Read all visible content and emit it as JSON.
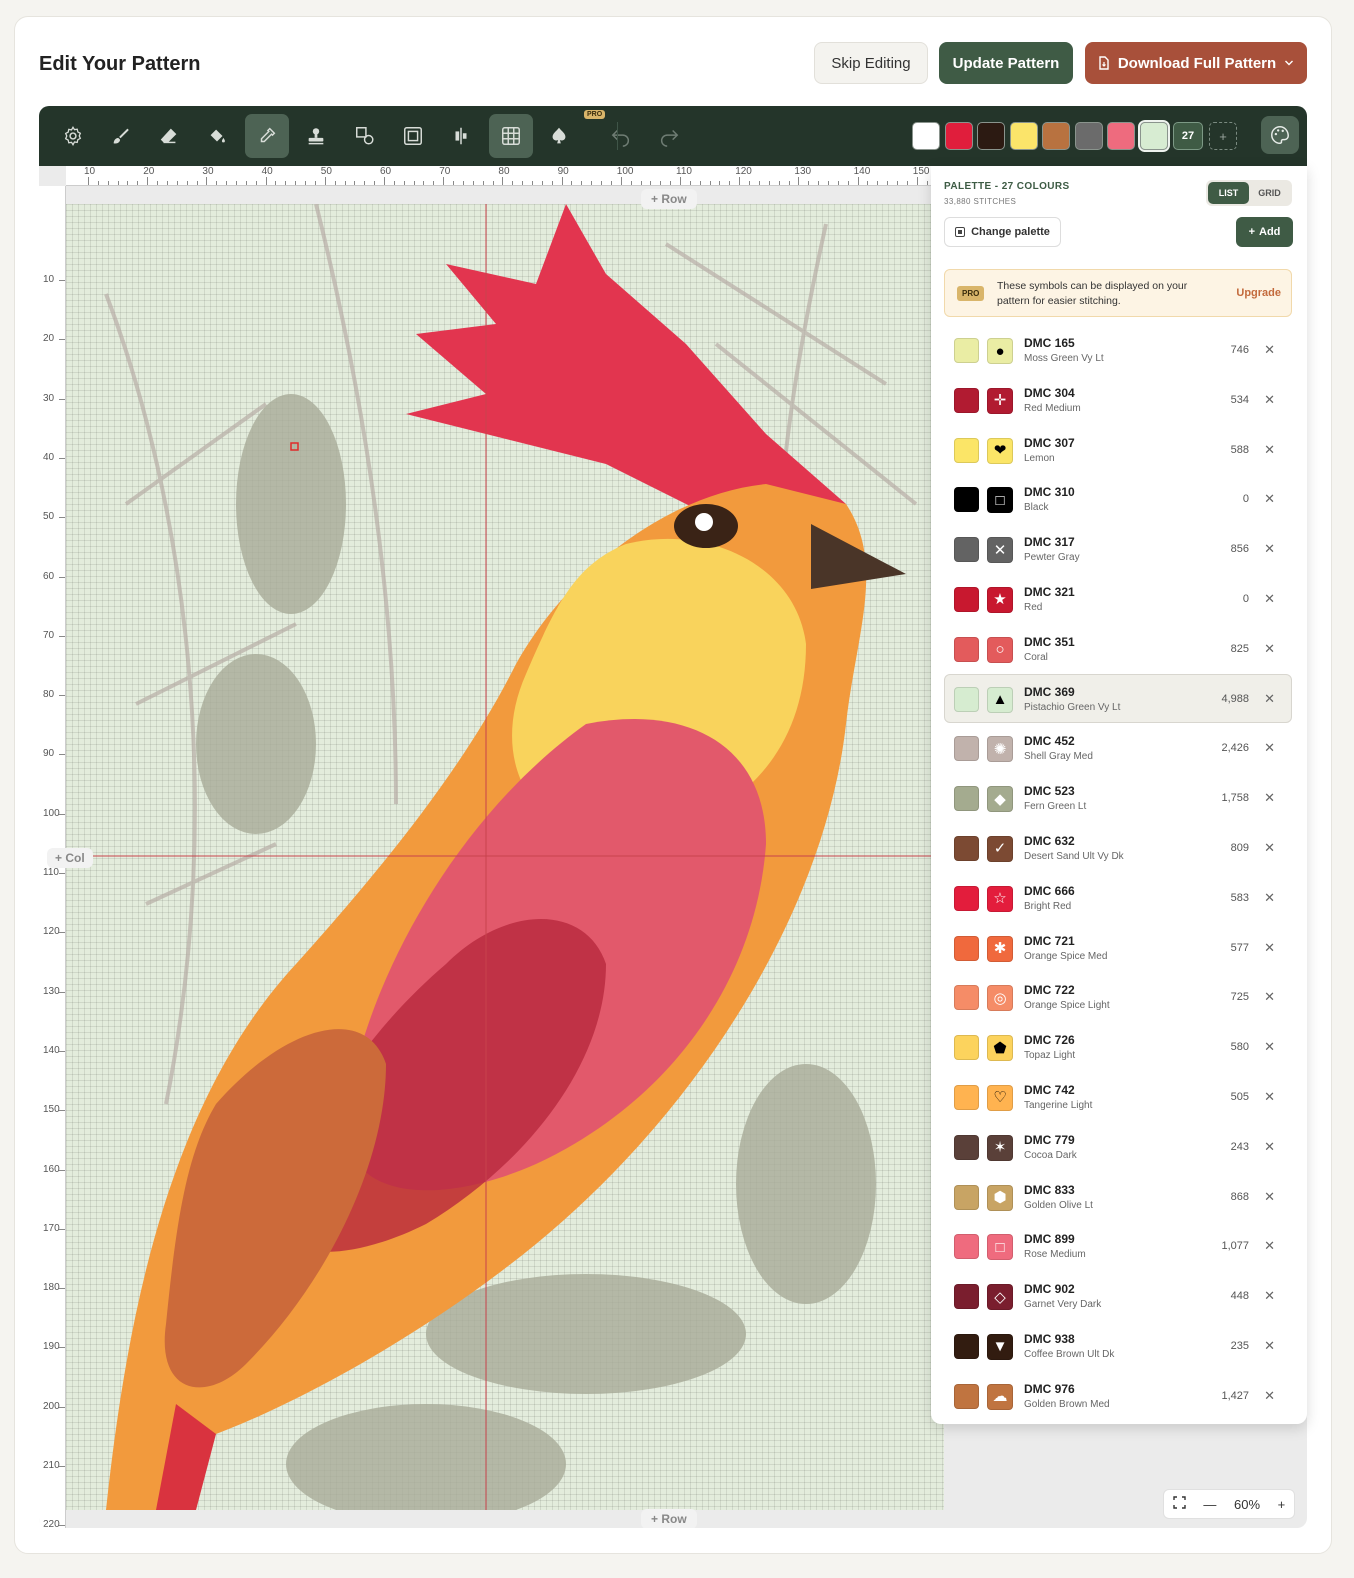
{
  "header": {
    "title": "Edit Your Pattern",
    "skip_label": "Skip Editing",
    "update_label": "Update Pattern",
    "download_label": "Download Full Pattern"
  },
  "toolbar": {
    "pro_badge": "PRO",
    "tools": [
      {
        "name": "settings-icon",
        "active": false
      },
      {
        "name": "brush-icon",
        "active": false
      },
      {
        "name": "eraser-icon",
        "active": false
      },
      {
        "name": "fill-bucket-icon",
        "active": false
      },
      {
        "name": "eyedropper-icon",
        "active": true
      },
      {
        "name": "stamp-icon",
        "active": false
      },
      {
        "name": "shapes-icon",
        "active": false
      },
      {
        "name": "frame-icon",
        "active": false
      },
      {
        "name": "align-icon",
        "active": false
      },
      {
        "name": "grid-icon",
        "active": true
      },
      {
        "name": "spade-icon",
        "active": false
      },
      {
        "name": "undo-icon",
        "active": false
      },
      {
        "name": "redo-icon",
        "active": false
      }
    ],
    "quick_swatches": [
      "#ffffff",
      "#e01e3c",
      "#2c1a12",
      "#fbe46a",
      "#b87240",
      "#6b6b6b",
      "#ee6b7e",
      "#d7ecd2"
    ],
    "selected_swatch": 7,
    "colour_count": "27",
    "add_symbol": "+"
  },
  "rulers": {
    "top": [
      "10",
      "20",
      "30",
      "40",
      "50",
      "60",
      "70",
      "80",
      "90",
      "100",
      "110",
      "120",
      "130",
      "140",
      "150"
    ],
    "left": [
      "10",
      "20",
      "30",
      "40",
      "50",
      "60",
      "70",
      "80",
      "90",
      "100",
      "110",
      "120",
      "130",
      "140",
      "150",
      "160",
      "170",
      "180",
      "190",
      "200",
      "210",
      "220"
    ]
  },
  "canvas": {
    "add_row_label": "+ Row",
    "add_col_label": "+ Col"
  },
  "palette": {
    "title": "PALETTE - 27 COLOURS",
    "stitches": "33,880 STITCHES",
    "view_list": "LIST",
    "view_grid": "GRID",
    "change_label": "Change palette",
    "add_label": "Add",
    "banner_pro": "PRO",
    "banner_text": "These symbols can be displayed on your pattern for easier stitching.",
    "banner_upgrade": "Upgrade",
    "items": [
      {
        "code": "DMC 165",
        "name": "Moss Green Vy Lt",
        "count": "746",
        "color": "#eaeda4",
        "symbol": "●",
        "sym_bg": "#eaeda4",
        "sym_fg": "#000000"
      },
      {
        "code": "DMC 304",
        "name": "Red Medium",
        "count": "534",
        "color": "#b11b31",
        "symbol": "✛",
        "sym_bg": "#b11b31",
        "sym_fg": "#ffffff"
      },
      {
        "code": "DMC 307",
        "name": "Lemon",
        "count": "588",
        "color": "#fbe567",
        "symbol": "❤",
        "sym_bg": "#fbe567",
        "sym_fg": "#000000"
      },
      {
        "code": "DMC 310",
        "name": "Black",
        "count": "0",
        "color": "#000000",
        "symbol": "□",
        "sym_bg": "#000000",
        "sym_fg": "#ffffff"
      },
      {
        "code": "DMC 317",
        "name": "Pewter Gray",
        "count": "856",
        "color": "#636363",
        "symbol": "✕",
        "sym_bg": "#636363",
        "sym_fg": "#ffffff"
      },
      {
        "code": "DMC 321",
        "name": "Red",
        "count": "0",
        "color": "#c8182f",
        "symbol": "★",
        "sym_bg": "#c8182f",
        "sym_fg": "#ffffff"
      },
      {
        "code": "DMC 351",
        "name": "Coral",
        "count": "825",
        "color": "#e35b5c",
        "symbol": "○",
        "sym_bg": "#e35b5c",
        "sym_fg": "#ffffff"
      },
      {
        "code": "DMC 369",
        "name": "Pistachio Green Vy Lt",
        "count": "4,988",
        "color": "#d6ecd0",
        "symbol": "▲",
        "sym_bg": "#d6ecd0",
        "sym_fg": "#000000"
      },
      {
        "code": "DMC 452",
        "name": "Shell Gray Med",
        "count": "2,426",
        "color": "#c1b2ac",
        "symbol": "✺",
        "sym_bg": "#c1b2ac",
        "sym_fg": "#ffffff"
      },
      {
        "code": "DMC 523",
        "name": "Fern Green Lt",
        "count": "1,758",
        "color": "#a4ab8f",
        "symbol": "◆",
        "sym_bg": "#a4ab8f",
        "sym_fg": "#ffffff"
      },
      {
        "code": "DMC 632",
        "name": "Desert Sand Ult Vy Dk",
        "count": "809",
        "color": "#7c4a33",
        "symbol": "✓",
        "sym_bg": "#7c4a33",
        "sym_fg": "#ffffff"
      },
      {
        "code": "DMC 666",
        "name": "Bright Red",
        "count": "583",
        "color": "#e31d3c",
        "symbol": "☆",
        "sym_bg": "#e31d3c",
        "sym_fg": "#ffffff"
      },
      {
        "code": "DMC 721",
        "name": "Orange Spice Med",
        "count": "577",
        "color": "#f0693d",
        "symbol": "✱",
        "sym_bg": "#f0693d",
        "sym_fg": "#ffffff"
      },
      {
        "code": "DMC 722",
        "name": "Orange Spice Light",
        "count": "725",
        "color": "#f58c67",
        "symbol": "◎",
        "sym_bg": "#f58c67",
        "sym_fg": "#ffffff"
      },
      {
        "code": "DMC 726",
        "name": "Topaz Light",
        "count": "580",
        "color": "#fcd35d",
        "symbol": "⬟",
        "sym_bg": "#fcd35d",
        "sym_fg": "#000000"
      },
      {
        "code": "DMC 742",
        "name": "Tangerine Light",
        "count": "505",
        "color": "#ffb350",
        "symbol": "♡",
        "sym_bg": "#ffb350",
        "sym_fg": "#000000"
      },
      {
        "code": "DMC 779",
        "name": "Cocoa Dark",
        "count": "243",
        "color": "#5a4039",
        "symbol": "✶",
        "sym_bg": "#5a4039",
        "sym_fg": "#ffffff"
      },
      {
        "code": "DMC 833",
        "name": "Golden Olive Lt",
        "count": "868",
        "color": "#c8a464",
        "symbol": "⬢",
        "sym_bg": "#c8a464",
        "sym_fg": "#ffffff"
      },
      {
        "code": "DMC 899",
        "name": "Rose Medium",
        "count": "1,077",
        "color": "#ef6b7e",
        "symbol": "□",
        "sym_bg": "#ef6b7e",
        "sym_fg": "#ffffff"
      },
      {
        "code": "DMC 902",
        "name": "Garnet Very Dark",
        "count": "448",
        "color": "#7a1e2e",
        "symbol": "◇",
        "sym_bg": "#7a1e2e",
        "sym_fg": "#ffffff"
      },
      {
        "code": "DMC 938",
        "name": "Coffee Brown Ult Dk",
        "count": "235",
        "color": "#321c10",
        "symbol": "▼",
        "sym_bg": "#321c10",
        "sym_fg": "#ffffff"
      },
      {
        "code": "DMC 976",
        "name": "Golden Brown Med",
        "count": "1,427",
        "color": "#c07440",
        "symbol": "☁",
        "sym_bg": "#c07440",
        "sym_fg": "#ffffff"
      }
    ],
    "selected_index": 7
  },
  "zoom": {
    "value": "60%",
    "minus": "—",
    "plus": "+"
  }
}
